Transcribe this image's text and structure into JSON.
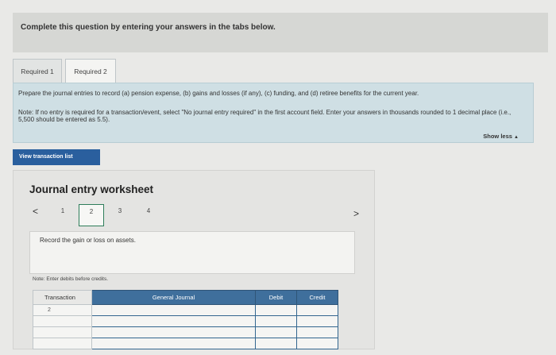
{
  "header": {
    "title": "Complete this question by entering your answers in the tabs below."
  },
  "tabs": [
    {
      "label": "Required 1"
    },
    {
      "label": "Required 2"
    }
  ],
  "instructions": {
    "paragraph1": "Prepare the journal entries to record (a) pension expense, (b) gains and losses (if any), (c) funding, and (d) retiree benefits for the current year.",
    "paragraph2": "Note: If no entry is required for a transaction/event, select \"No journal entry required\" in the first account field. Enter your answers in thousands rounded to 1 decimal place (i.e., 5,500 should be entered as 5.5).",
    "show_less": "Show less"
  },
  "view_transaction_button": "View transaction list",
  "worksheet": {
    "title": "Journal entry worksheet",
    "pager": {
      "prev": "<",
      "next": ">",
      "pages": [
        "1",
        "2",
        "3",
        "4"
      ],
      "current": "2"
    },
    "description": "Record the gain or loss on assets.",
    "note": "Note: Enter debits before credits.",
    "table": {
      "headers": {
        "transaction": "Transaction",
        "general_journal": "General Journal",
        "debit": "Debit",
        "credit": "Credit"
      },
      "rows": [
        {
          "transaction": "2",
          "account": "",
          "debit": "",
          "credit": ""
        },
        {
          "transaction": "",
          "account": "",
          "debit": "",
          "credit": ""
        },
        {
          "transaction": "",
          "account": "",
          "debit": "",
          "credit": ""
        },
        {
          "transaction": "",
          "account": "",
          "debit": "",
          "credit": ""
        }
      ]
    }
  }
}
